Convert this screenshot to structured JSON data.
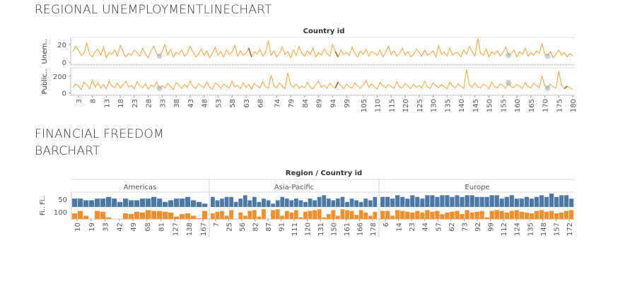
{
  "line_section": {
    "title": "REGIONAL UNEMPLOYMENTLINECHART",
    "header": "Country id",
    "row_labels": [
      "Public.. Unem..",
      "Public.. Unem.."
    ],
    "row_label_short": [
      "Unem..",
      "Public.."
    ],
    "y_ticks_top": [
      "20",
      "0"
    ],
    "y_ticks_bottom": [
      "200",
      "0"
    ],
    "x_ticks": [
      "3",
      "8",
      "13",
      "18",
      "23",
      "28",
      "33",
      "38",
      "43",
      "48",
      "53",
      "58",
      "63",
      "68",
      "74",
      "79",
      "84",
      "89",
      "94",
      "99",
      "105",
      "110",
      "115",
      "120",
      "125",
      "130",
      "135",
      "140",
      "145",
      "150",
      "155",
      "160",
      "165",
      "170",
      "175",
      "180"
    ]
  },
  "bar_section": {
    "title_line1": "FINANCIAL  FREEDOM",
    "title_line2": "BARCHART",
    "header": "Region  /  Country id",
    "row_label": "Fi.. Fi..",
    "y_tick_top": "50",
    "y_tick_bottom": "100",
    "regions": [
      {
        "name": "Americas",
        "ticks": [
          "10",
          "19",
          "33",
          "42",
          "49",
          "68",
          "81",
          "127",
          "138",
          "167"
        ]
      },
      {
        "name": "Asia-Pacific",
        "ticks": [
          "7",
          "25",
          "56",
          "82",
          "87",
          "91",
          "111",
          "120",
          "131",
          "150",
          "161",
          "166",
          "178"
        ]
      },
      {
        "name": "Europe",
        "ticks": [
          "6",
          "14",
          "23",
          "44",
          "57",
          "62",
          "73",
          "92",
          "99",
          "112",
          "124",
          "135",
          "148",
          "157",
          "172"
        ]
      }
    ]
  },
  "colors": {
    "line_primary": "#f2a849",
    "line_secondary": "#9aa7b2",
    "line_accent": "#b45a2a",
    "bar_blue": "#4e79a7",
    "bar_orange": "#f28e2b",
    "grid": "#e6e6e6",
    "axis": "#999999"
  },
  "chart_data": [
    {
      "type": "line",
      "title": "REGIONAL UNEMPLOYMENTLINECHART",
      "xlabel": "Country id",
      "ylabel": "Unem..",
      "ylim": [
        -3,
        28
      ],
      "x_start": 1,
      "series": [
        {
          "values": [
            12,
            18,
            14,
            8,
            10,
            22,
            9,
            6,
            12,
            15,
            8,
            17,
            5,
            11,
            9,
            14,
            7,
            19,
            12,
            6,
            10,
            8,
            14,
            11,
            7,
            16,
            9,
            5,
            13,
            18,
            10,
            7,
            12,
            20,
            8,
            15,
            6,
            11,
            9,
            14,
            7,
            10,
            18,
            12,
            6,
            9,
            15,
            8,
            13,
            5,
            10,
            17,
            8,
            12,
            6,
            14,
            9,
            11,
            19,
            7,
            13,
            8,
            10,
            16,
            6,
            12,
            9,
            15,
            7,
            11,
            24,
            8,
            13,
            6,
            10,
            17,
            9,
            12,
            5,
            14,
            8,
            18,
            10,
            7,
            13,
            9,
            16,
            6,
            11,
            8,
            15,
            10,
            7,
            20,
            12,
            6,
            14,
            9,
            11,
            8,
            17,
            10,
            6,
            13,
            9,
            15,
            7,
            12,
            10,
            8,
            14,
            6,
            11,
            18,
            9,
            13,
            7,
            10,
            16,
            8,
            12,
            6,
            9,
            15,
            11,
            7,
            14,
            8,
            10,
            13,
            6,
            19,
            9,
            12,
            7,
            16,
            8,
            11,
            10,
            6,
            14,
            9,
            18,
            12,
            7,
            27,
            10,
            8,
            15,
            6,
            12,
            9,
            13,
            7,
            11,
            17,
            8,
            10,
            14,
            6,
            12,
            9,
            16,
            7,
            11,
            8,
            13,
            10,
            21,
            9,
            7,
            12,
            5,
            9,
            14,
            8,
            11,
            6,
            10,
            7
          ]
        }
      ]
    },
    {
      "type": "line",
      "title": "",
      "xlabel": "Country id",
      "ylabel": "Public..",
      "ylim": [
        -30,
        300
      ],
      "x_start": 1,
      "series": [
        {
          "values": [
            60,
            110,
            80,
            40,
            130,
            95,
            50,
            150,
            70,
            120,
            60,
            100,
            45,
            140,
            80,
            65,
            120,
            55,
            100,
            140,
            70,
            90,
            50,
            135,
            80,
            60,
            110,
            45,
            95,
            70,
            130,
            55,
            85,
            60,
            115,
            70,
            40,
            125,
            90,
            55,
            100,
            65,
            140,
            75,
            50,
            110,
            85,
            60,
            130,
            70,
            45,
            120,
            95,
            55,
            105,
            80,
            60,
            140,
            70,
            90,
            50,
            125,
            65,
            100,
            45,
            115,
            80,
            60,
            135,
            70,
            55,
            210,
            85,
            60,
            120,
            75,
            50,
            240,
            95,
            65,
            110,
            55,
            80,
            60,
            125,
            70,
            45,
            100,
            140,
            65,
            90,
            55,
            115,
            75,
            60,
            130,
            85,
            50,
            105,
            70,
            60,
            120,
            80,
            55,
            95,
            150,
            65,
            110,
            70,
            50,
            125,
            85,
            60,
            100,
            75,
            55,
            135,
            70,
            60,
            115,
            80,
            50,
            105,
            65,
            90,
            60,
            140,
            75,
            55,
            120,
            85,
            60,
            100,
            70,
            50,
            130,
            80,
            60,
            110,
            75,
            55,
            280,
            95,
            65,
            120,
            70,
            60,
            105,
            85,
            50,
            130,
            75,
            60,
            110,
            90,
            55,
            120,
            70,
            65,
            100,
            80,
            55,
            125,
            75,
            60,
            115,
            90,
            60,
            200,
            85,
            55,
            105,
            70,
            60,
            260,
            90,
            50,
            80,
            60,
            40
          ]
        }
      ]
    },
    {
      "type": "bar",
      "title": "FINANCIAL  FREEDOM BARCHART",
      "xlabel": "Region  /  Country id",
      "ylabel": "Fi..",
      "ylim": [
        0,
        80
      ],
      "regions": [
        {
          "name": "Americas",
          "values": [
            50,
            50,
            40,
            40,
            50,
            50,
            60,
            50,
            30,
            50,
            40,
            40,
            50,
            50,
            60,
            50,
            30,
            40,
            50,
            50,
            60,
            40,
            30,
            20
          ]
        },
        {
          "name": "Asia-Pacific",
          "values": [
            60,
            40,
            50,
            60,
            60,
            30,
            50,
            70,
            40,
            60,
            30,
            50,
            40,
            20,
            40,
            60,
            50,
            40,
            50,
            40,
            30,
            50,
            40,
            60,
            70,
            50,
            40,
            50,
            60,
            30,
            50,
            40,
            30,
            50,
            40,
            60
          ]
        },
        {
          "name": "Europe",
          "values": [
            60,
            60,
            50,
            70,
            60,
            50,
            70,
            60,
            50,
            70,
            70,
            60,
            70,
            70,
            60,
            70,
            60,
            70,
            70,
            60,
            60,
            60,
            70,
            70,
            50,
            60,
            70,
            50,
            50,
            60,
            50,
            60,
            70,
            60,
            80,
            60,
            70,
            70,
            50
          ]
        }
      ]
    },
    {
      "type": "bar",
      "title": "",
      "xlabel": "Region  /  Country id",
      "ylabel": "Fi..",
      "ylim": [
        0,
        140
      ],
      "regions": [
        {
          "name": "Americas",
          "values": [
            70,
            100,
            40,
            0,
            100,
            90,
            20,
            0,
            0,
            70,
            60,
            90,
            80,
            110,
            100,
            100,
            90,
            80,
            30,
            60,
            70,
            40,
            10,
            100
          ]
        },
        {
          "name": "Asia-Pacific",
          "values": [
            70,
            90,
            100,
            40,
            110,
            0,
            80,
            40,
            100,
            110,
            30,
            120,
            0,
            110,
            120,
            40,
            100,
            80,
            110,
            20,
            90,
            100,
            110,
            120,
            20,
            60,
            110,
            40,
            120,
            110,
            100,
            50,
            110,
            80,
            40,
            90
          ]
        },
        {
          "name": "Europe",
          "values": [
            100,
            100,
            40,
            110,
            100,
            90,
            80,
            100,
            80,
            110,
            90,
            100,
            60,
            80,
            90,
            100,
            60,
            110,
            80,
            90,
            100,
            20,
            100,
            110,
            100,
            80,
            100,
            110,
            90,
            80,
            70,
            100,
            110,
            90,
            100,
            70,
            80,
            100,
            110
          ]
        }
      ]
    }
  ]
}
